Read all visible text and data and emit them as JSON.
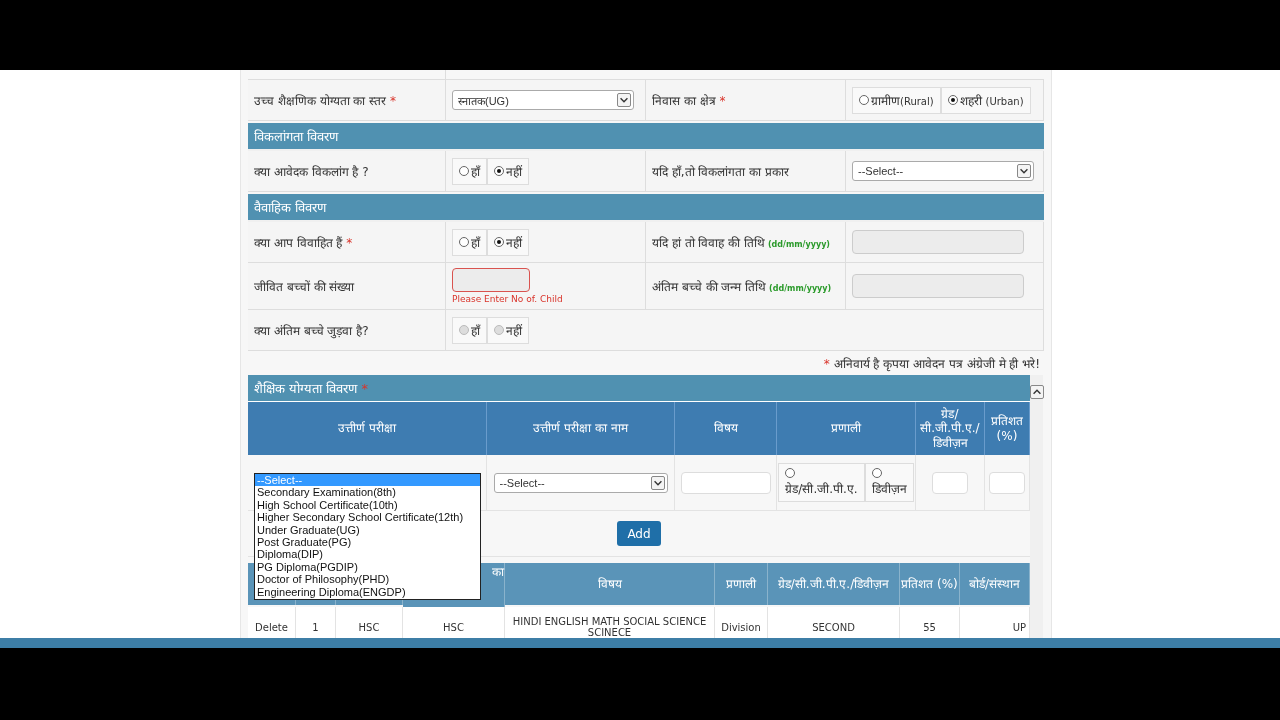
{
  "form_sections": [
    {
      "rows": [
        {
          "cells": [
            {
              "kind": "label",
              "text": "उच्च शैक्षणिक योग्यता का स्तर",
              "mark": "*"
            },
            {
              "kind": "select",
              "value": "स्नातक(UG)"
            },
            {
              "kind": "label",
              "text": "निवास का क्षेत्र",
              "mark": "*"
            },
            {
              "kind": "radios",
              "disabled": false,
              "options": [
                {
                  "label": "ग्रामीण(Rural)",
                  "selected": false
                },
                {
                  "label": "शहरी (Urban)",
                  "selected": true
                }
              ]
            }
          ]
        }
      ]
    },
    {
      "title": "विकलांगता विवरण",
      "rows": [
        {
          "cells": [
            {
              "kind": "label",
              "text": "क्या आवेदक विकलांग है ?"
            },
            {
              "kind": "radios",
              "disabled": false,
              "options": [
                {
                  "label": "हाँ",
                  "selected": false
                },
                {
                  "label": "नहीं",
                  "selected": true
                }
              ]
            },
            {
              "kind": "label",
              "text": "यदि हाँ,तो विकलांगता का प्रकार"
            },
            {
              "kind": "select",
              "value": "--Select--"
            }
          ]
        }
      ]
    },
    {
      "title": "वैवाहिक विवरण",
      "rows": [
        {
          "cells": [
            {
              "kind": "label",
              "text": "क्या आप विवाहित हैं",
              "mark": "*"
            },
            {
              "kind": "radios",
              "disabled": false,
              "options": [
                {
                  "label": "हाँ",
                  "selected": false
                },
                {
                  "label": "नहीं",
                  "selected": true
                }
              ]
            },
            {
              "kind": "label",
              "text": "यदि हां तो विवाह की तिथि",
              "hint": "(dd/mm/yyyy)"
            },
            {
              "kind": "input",
              "disabled": true,
              "invalid": false
            }
          ]
        },
        {
          "cells": [
            {
              "kind": "label",
              "text": "जीवित बच्चों की संख्या"
            },
            {
              "kind": "input",
              "disabled": false,
              "invalid": true,
              "error": "Please Enter No of. Child"
            },
            {
              "kind": "label",
              "text": "अंतिम बच्चे की जन्म तिथि",
              "hint": "(dd/mm/yyyy)"
            },
            {
              "kind": "input",
              "disabled": true,
              "invalid": false
            }
          ]
        },
        {
          "cells": [
            {
              "kind": "label",
              "text": "क्या अंतिम बच्चे जुड़वा है?"
            },
            {
              "kind": "radios",
              "disabled": true,
              "options": [
                {
                  "label": "हाँ",
                  "selected": false
                },
                {
                  "label": "नहीं",
                  "selected": false
                }
              ]
            }
          ]
        }
      ]
    }
  ],
  "note": {
    "mark": "*",
    "text": "अनिवार्य है कृपया आवेदन पत्र अंग्रेजी मे ही भरे!"
  },
  "education": {
    "title": "शैक्षिक योग्यता विवरण",
    "mark": "*",
    "columns": [
      "उत्तीर्ण परीक्षा",
      "उत्तीर्ण परीक्षा का नाम",
      "विषय",
      "प्रणाली",
      "ग्रेड/ सी.जी.पी.ए./ डिवीज़न",
      "प्रतिशत (%)"
    ],
    "exam_options": [
      {
        "label": "--Select--",
        "selected": true
      },
      {
        "label": "Secondary Examination(8th)",
        "selected": false
      },
      {
        "label": "High School Certificate(10th)",
        "selected": false
      },
      {
        "label": "Higher Secondary School Certificate(12th)",
        "selected": false
      },
      {
        "label": "Under Graduate(UG)",
        "selected": false
      },
      {
        "label": "Post Graduate(PG)",
        "selected": false
      },
      {
        "label": "Diploma(DIP)",
        "selected": false
      },
      {
        "label": "PG Diploma(PGDIP)",
        "selected": false
      },
      {
        "label": "Doctor of Philosophy(PHD)",
        "selected": false
      },
      {
        "label": "Engineering Diploma(ENGDP)",
        "selected": false
      }
    ],
    "name_select": "--Select--",
    "system_options": [
      {
        "label": "ग्रेड/सी.जी.पी.ए.",
        "selected": false
      },
      {
        "label": "डिवीज़न",
        "selected": false
      }
    ],
    "add_button": "Add",
    "records": {
      "columns": [
        "",
        "",
        "",
        "का",
        "विषय",
        "प्रणाली",
        "ग्रेड/सी.जी.पी.ए./डिवीज़न",
        "प्रतिशत (%)",
        "बोर्ड/संस्थान"
      ],
      "rows": [
        [
          "Delete",
          "1",
          "HSC",
          "HSC",
          "HINDI ENGLISH MATH SOCIAL SCIENCE SCINECE",
          "Division",
          "SECOND",
          "55",
          "UP"
        ]
      ]
    }
  }
}
